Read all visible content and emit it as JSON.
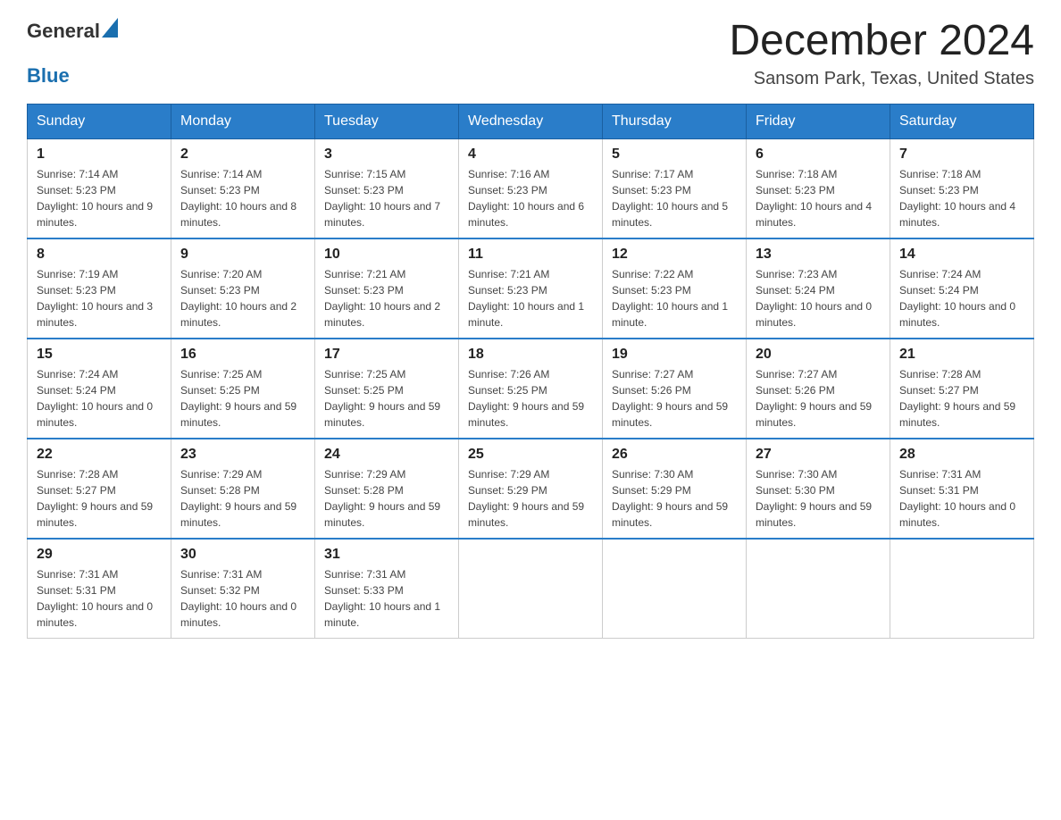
{
  "header": {
    "logo": {
      "general": "General",
      "blue": "Blue"
    },
    "title": "December 2024",
    "location": "Sansom Park, Texas, United States"
  },
  "days": [
    "Sunday",
    "Monday",
    "Tuesday",
    "Wednesday",
    "Thursday",
    "Friday",
    "Saturday"
  ],
  "weeks": [
    [
      {
        "day": "1",
        "sunrise": "7:14 AM",
        "sunset": "5:23 PM",
        "daylight": "10 hours and 9 minutes."
      },
      {
        "day": "2",
        "sunrise": "7:14 AM",
        "sunset": "5:23 PM",
        "daylight": "10 hours and 8 minutes."
      },
      {
        "day": "3",
        "sunrise": "7:15 AM",
        "sunset": "5:23 PM",
        "daylight": "10 hours and 7 minutes."
      },
      {
        "day": "4",
        "sunrise": "7:16 AM",
        "sunset": "5:23 PM",
        "daylight": "10 hours and 6 minutes."
      },
      {
        "day": "5",
        "sunrise": "7:17 AM",
        "sunset": "5:23 PM",
        "daylight": "10 hours and 5 minutes."
      },
      {
        "day": "6",
        "sunrise": "7:18 AM",
        "sunset": "5:23 PM",
        "daylight": "10 hours and 4 minutes."
      },
      {
        "day": "7",
        "sunrise": "7:18 AM",
        "sunset": "5:23 PM",
        "daylight": "10 hours and 4 minutes."
      }
    ],
    [
      {
        "day": "8",
        "sunrise": "7:19 AM",
        "sunset": "5:23 PM",
        "daylight": "10 hours and 3 minutes."
      },
      {
        "day": "9",
        "sunrise": "7:20 AM",
        "sunset": "5:23 PM",
        "daylight": "10 hours and 2 minutes."
      },
      {
        "day": "10",
        "sunrise": "7:21 AM",
        "sunset": "5:23 PM",
        "daylight": "10 hours and 2 minutes."
      },
      {
        "day": "11",
        "sunrise": "7:21 AM",
        "sunset": "5:23 PM",
        "daylight": "10 hours and 1 minute."
      },
      {
        "day": "12",
        "sunrise": "7:22 AM",
        "sunset": "5:23 PM",
        "daylight": "10 hours and 1 minute."
      },
      {
        "day": "13",
        "sunrise": "7:23 AM",
        "sunset": "5:24 PM",
        "daylight": "10 hours and 0 minutes."
      },
      {
        "day": "14",
        "sunrise": "7:24 AM",
        "sunset": "5:24 PM",
        "daylight": "10 hours and 0 minutes."
      }
    ],
    [
      {
        "day": "15",
        "sunrise": "7:24 AM",
        "sunset": "5:24 PM",
        "daylight": "10 hours and 0 minutes."
      },
      {
        "day": "16",
        "sunrise": "7:25 AM",
        "sunset": "5:25 PM",
        "daylight": "9 hours and 59 minutes."
      },
      {
        "day": "17",
        "sunrise": "7:25 AM",
        "sunset": "5:25 PM",
        "daylight": "9 hours and 59 minutes."
      },
      {
        "day": "18",
        "sunrise": "7:26 AM",
        "sunset": "5:25 PM",
        "daylight": "9 hours and 59 minutes."
      },
      {
        "day": "19",
        "sunrise": "7:27 AM",
        "sunset": "5:26 PM",
        "daylight": "9 hours and 59 minutes."
      },
      {
        "day": "20",
        "sunrise": "7:27 AM",
        "sunset": "5:26 PM",
        "daylight": "9 hours and 59 minutes."
      },
      {
        "day": "21",
        "sunrise": "7:28 AM",
        "sunset": "5:27 PM",
        "daylight": "9 hours and 59 minutes."
      }
    ],
    [
      {
        "day": "22",
        "sunrise": "7:28 AM",
        "sunset": "5:27 PM",
        "daylight": "9 hours and 59 minutes."
      },
      {
        "day": "23",
        "sunrise": "7:29 AM",
        "sunset": "5:28 PM",
        "daylight": "9 hours and 59 minutes."
      },
      {
        "day": "24",
        "sunrise": "7:29 AM",
        "sunset": "5:28 PM",
        "daylight": "9 hours and 59 minutes."
      },
      {
        "day": "25",
        "sunrise": "7:29 AM",
        "sunset": "5:29 PM",
        "daylight": "9 hours and 59 minutes."
      },
      {
        "day": "26",
        "sunrise": "7:30 AM",
        "sunset": "5:29 PM",
        "daylight": "9 hours and 59 minutes."
      },
      {
        "day": "27",
        "sunrise": "7:30 AM",
        "sunset": "5:30 PM",
        "daylight": "9 hours and 59 minutes."
      },
      {
        "day": "28",
        "sunrise": "7:31 AM",
        "sunset": "5:31 PM",
        "daylight": "10 hours and 0 minutes."
      }
    ],
    [
      {
        "day": "29",
        "sunrise": "7:31 AM",
        "sunset": "5:31 PM",
        "daylight": "10 hours and 0 minutes."
      },
      {
        "day": "30",
        "sunrise": "7:31 AM",
        "sunset": "5:32 PM",
        "daylight": "10 hours and 0 minutes."
      },
      {
        "day": "31",
        "sunrise": "7:31 AM",
        "sunset": "5:33 PM",
        "daylight": "10 hours and 1 minute."
      },
      null,
      null,
      null,
      null
    ]
  ]
}
